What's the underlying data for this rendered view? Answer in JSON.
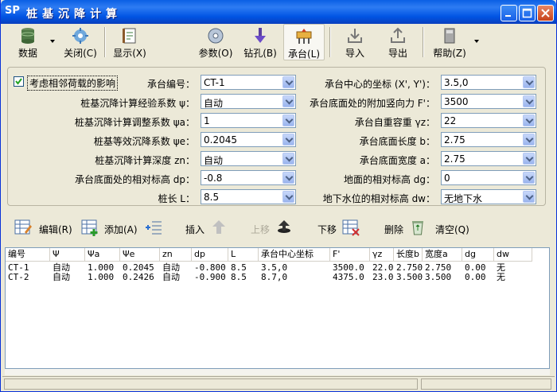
{
  "window": {
    "logo": "SP",
    "title": "桩基沉降计算"
  },
  "toolbar": {
    "data": "数据",
    "close": "关闭(C)",
    "display": "显示(X)",
    "params": "参数(O)",
    "drill": "钻孔(B)",
    "cap": "承台(L)",
    "import": "导入",
    "export": "导出",
    "help": "帮助(Z)"
  },
  "form": {
    "consider_adjacent": "考虑相邻荷载的影响",
    "left": [
      {
        "label": "承台编号：",
        "value": "CT-1"
      },
      {
        "label": "桩基沉降计算经验系数 ψ：",
        "value": "自动"
      },
      {
        "label": "桩基沉降计算调整系数 ψa：",
        "value": "1"
      },
      {
        "label": "桩基等效沉降系数 ψe：",
        "value": "0.2045"
      },
      {
        "label": "桩基沉降计算深度 zn：",
        "value": "自动"
      },
      {
        "label": "承台底面处的相对标高 dp：",
        "value": "-0.8"
      },
      {
        "label": "桩长 L：",
        "value": "8.5"
      }
    ],
    "right": [
      {
        "label": "承台中心的坐标 (X', Y')：",
        "value": "3.5,0"
      },
      {
        "label": "承台底面处的附加竖向力 F'：",
        "value": "3500"
      },
      {
        "label": "承台自重容重 γz：",
        "value": "22"
      },
      {
        "label": "承台底面长度 b：",
        "value": "2.75"
      },
      {
        "label": "承台底面宽度 a：",
        "value": "2.75"
      },
      {
        "label": "地面的相对标高 dg：",
        "value": "0"
      },
      {
        "label": "地下水位的相对标高 dw：",
        "value": "无地下水"
      }
    ]
  },
  "actions": {
    "edit": "编辑(R)",
    "add": "添加(A)",
    "insert": "插入",
    "move_up": "上移",
    "move_down": "下移",
    "delete": "删除",
    "clear": "清空(Q)"
  },
  "table": {
    "columns": [
      "编号",
      "Ψ",
      "Ψa",
      "Ψe",
      "zn",
      "dp",
      "L",
      "承台中心坐标",
      "F'",
      "γz",
      "长度b",
      "宽度a",
      "dg",
      "dw"
    ],
    "rows": [
      [
        "CT-1",
        "自动",
        "1.000",
        "0.2045",
        "自动",
        "-0.800",
        "8.5",
        "3.5,0",
        "3500.0",
        "22.0",
        "2.750",
        "2.750",
        "0.00",
        "无"
      ],
      [
        "CT-2",
        "自动",
        "1.000",
        "0.2426",
        "自动",
        "-0.900",
        "8.5",
        "8.7,0",
        "4375.0",
        "23.0",
        "3.500",
        "3.500",
        "0.00",
        "无"
      ]
    ]
  },
  "colors": {
    "titlebar": "#0054E3",
    "chrome": "#ECE9D8",
    "field_border": "#7F9DB9"
  }
}
